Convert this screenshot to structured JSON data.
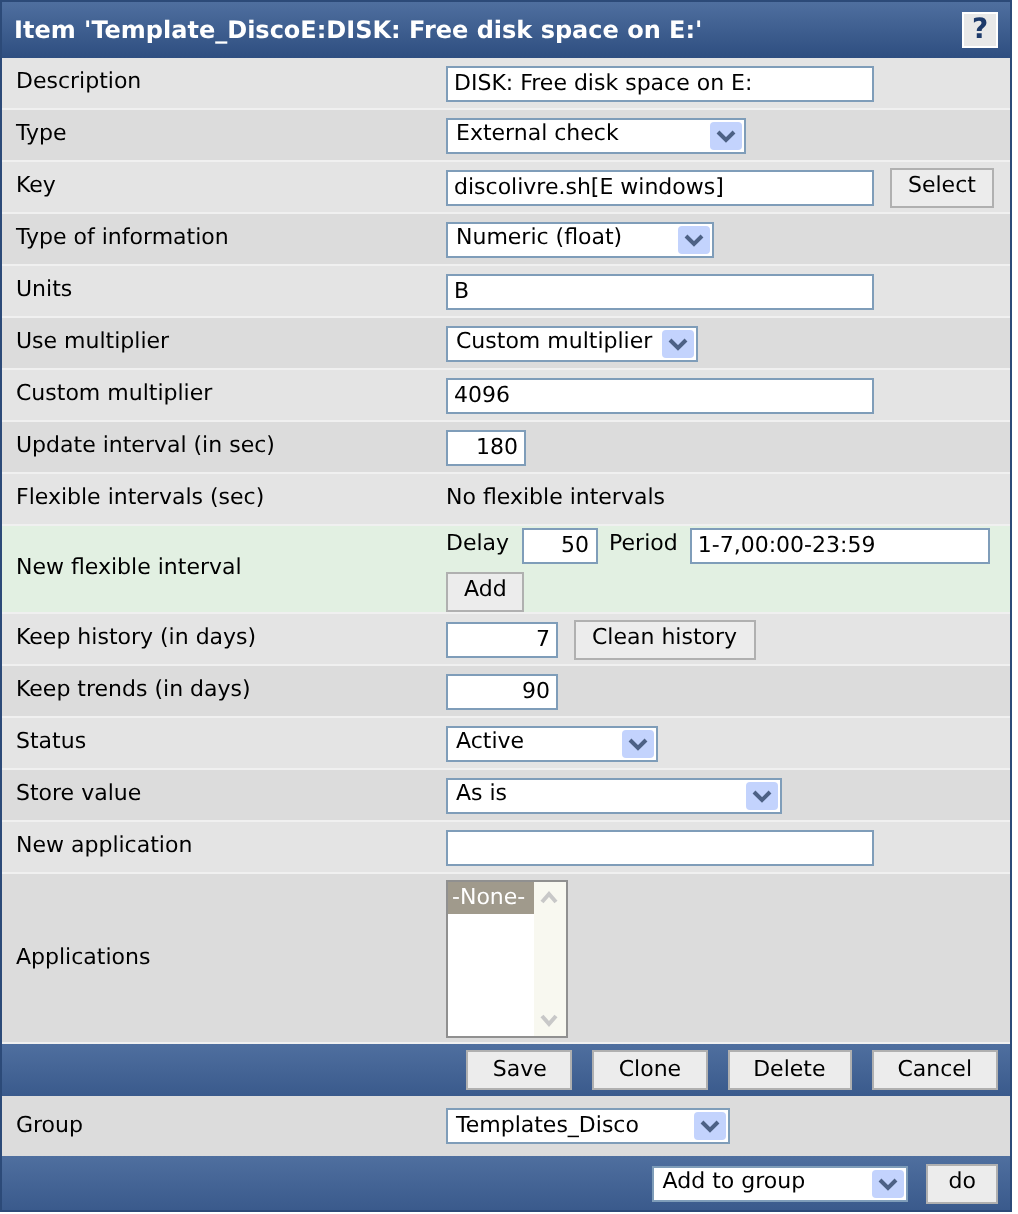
{
  "title": "Item 'Template_DiscoE:DISK: Free disk space on E:'",
  "help": "?",
  "rows": [
    {
      "label": "Description",
      "kind": "text_field",
      "value": "DISK: Free disk space on E:"
    },
    {
      "label": "Type",
      "kind": "select",
      "value": "External check"
    },
    {
      "label": "Key",
      "kind": "text_field",
      "value": "discolivre.sh[E windows]",
      "button": "Select"
    },
    {
      "label": "Type of information",
      "kind": "select",
      "value": "Numeric (float)"
    },
    {
      "label": "Units",
      "kind": "text_field",
      "value": "B"
    },
    {
      "label": "Use multiplier",
      "kind": "select",
      "value": "Custom multiplier"
    },
    {
      "label": "Custom multiplier",
      "kind": "text_field",
      "value": "4096"
    },
    {
      "label": "Update interval (in sec)",
      "kind": "number_field",
      "value": "180"
    },
    {
      "label": "Flexible intervals (sec)",
      "kind": "text",
      "value": "No flexible intervals"
    },
    {
      "label": "New flexible interval",
      "kind": "flex_interval",
      "delay_label": "Delay",
      "delay": "50",
      "period_label": "Period",
      "period": "1-7,00:00-23:59",
      "button": "Add"
    },
    {
      "label": "Keep history (in days)",
      "kind": "number_field",
      "value": "7",
      "button": "Clean history"
    },
    {
      "label": "Keep trends (in days)",
      "kind": "number_field",
      "value": "90"
    },
    {
      "label": "Status",
      "kind": "select",
      "value": "Active"
    },
    {
      "label": "Store value",
      "kind": "select",
      "value": "As is"
    },
    {
      "label": "New application",
      "kind": "text_field",
      "value": ""
    },
    {
      "label": "Applications",
      "kind": "listbox",
      "options": [
        {
          "label": "-None-",
          "selected": true
        }
      ]
    }
  ],
  "actions": [
    "Save",
    "Clone",
    "Delete",
    "Cancel"
  ],
  "group": {
    "label": "Group",
    "value": "Templates_Disco"
  },
  "footer": {
    "select": "Add to group",
    "button": "do"
  }
}
